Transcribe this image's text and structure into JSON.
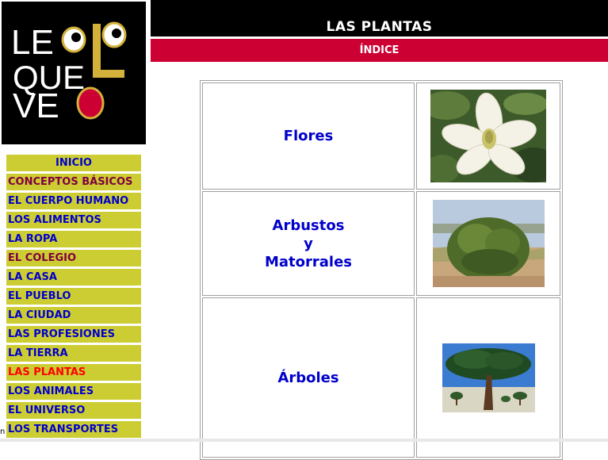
{
  "logo": {
    "line1": "LEOLO",
    "line2": "QUE",
    "line3": "VEO",
    "bg_color": "#000000",
    "accent_color": "#d4b13a"
  },
  "header": {
    "title": "LAS PLANTAS",
    "subtitle": "ÍNDICE"
  },
  "sidebar": {
    "items": [
      {
        "label": "INICIO"
      },
      {
        "label": "CONCEPTOS BÁSICOS"
      },
      {
        "label": "EL CUERPO HUMANO"
      },
      {
        "label": "LOS ALIMENTOS"
      },
      {
        "label": "LA ROPA"
      },
      {
        "label": "EL COLEGIO"
      },
      {
        "label": "LA CASA"
      },
      {
        "label": "EL PUEBLO"
      },
      {
        "label": "LA CIUDAD"
      },
      {
        "label": "LAS PROFESIONES"
      },
      {
        "label": "LA TIERRA"
      },
      {
        "label": "LAS PLANTAS"
      },
      {
        "label": "LOS ANIMALES"
      },
      {
        "label": "EL UNIVERSO"
      },
      {
        "label": "LOS TRANSPORTES"
      }
    ]
  },
  "content": {
    "rows": [
      {
        "label": "Flores",
        "image": "magnolia-flower-photo"
      },
      {
        "label_lines": [
          "Arbustos",
          "y",
          "Matorrales"
        ],
        "image": "shrub-photo"
      },
      {
        "label": "Árboles",
        "image": "pine-tree-photo"
      }
    ]
  },
  "edge_text": "n",
  "colors": {
    "menu_bg": "#cccc33",
    "menu_link": "#0000cc",
    "menu_visited": "#800040",
    "menu_active": "#ff0000",
    "index_bar": "#cc0033"
  }
}
